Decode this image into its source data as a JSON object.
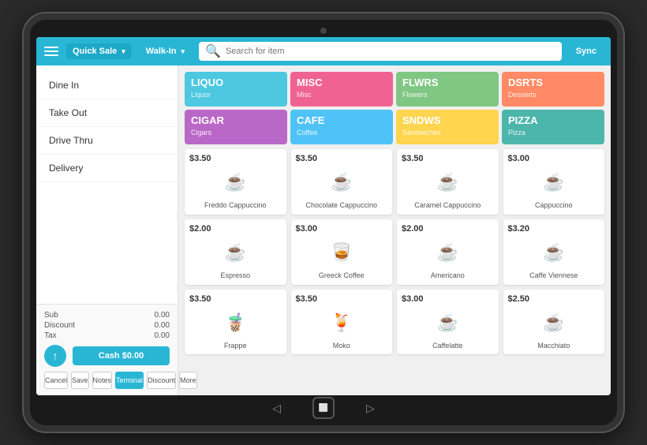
{
  "tablet": {
    "topBar": {
      "quickSale": "Quick Sale",
      "walkIn": "Walk-In",
      "searchPlaceholder": "Search for item",
      "sync": "Sync"
    },
    "leftMenu": {
      "items": [
        {
          "label": "Dine In"
        },
        {
          "label": "Take Out"
        },
        {
          "label": "Drive Thru"
        },
        {
          "label": "Delivery"
        }
      ]
    },
    "summary": {
      "sub": {
        "label": "Sub",
        "value": "0.00"
      },
      "discount": {
        "label": "Discount",
        "value": "0.00"
      },
      "tax": {
        "label": "Tax",
        "value": "0.00"
      }
    },
    "cashButton": "Cash $0.00",
    "bottomButtons": [
      {
        "label": "Cancel",
        "active": false
      },
      {
        "label": "Save",
        "active": false
      },
      {
        "label": "Notes",
        "active": false
      },
      {
        "label": "Terminal",
        "active": true
      },
      {
        "label": "Discount",
        "active": false
      },
      {
        "label": "More",
        "active": false
      }
    ],
    "categories": [
      {
        "name": "LIQUO",
        "sub": "Liquor",
        "color": "#4dc8e0"
      },
      {
        "name": "MISC",
        "sub": "Misc",
        "color": "#f06292"
      },
      {
        "name": "FLWRS",
        "sub": "Flowers",
        "color": "#81c784"
      },
      {
        "name": "DSRTS",
        "sub": "Desserts",
        "color": "#ff8a65"
      },
      {
        "name": "CIGAR",
        "sub": "Cigars",
        "color": "#ba68c8"
      },
      {
        "name": "CAFE",
        "sub": "Coffee",
        "color": "#4fc3f7"
      },
      {
        "name": "SNDWS",
        "sub": "Sandwiches",
        "color": "#ffd54f"
      },
      {
        "name": "PIZZA",
        "sub": "Pizza",
        "color": "#4db6ac"
      }
    ],
    "products": [
      {
        "name": "Freddo Cappuccino",
        "price": "$3.50",
        "icon": "☕"
      },
      {
        "name": "Chocolate Cappuccino",
        "price": "$3.50",
        "icon": "☕"
      },
      {
        "name": "Caramel Cappuccino",
        "price": "$3.50",
        "icon": "☕"
      },
      {
        "name": "Cappuccino",
        "price": "$3.00",
        "icon": "☕"
      },
      {
        "name": "Espresso",
        "price": "$2.00",
        "icon": "☕"
      },
      {
        "name": "Greeck Coffee",
        "price": "$3.00",
        "icon": "🥃"
      },
      {
        "name": "Americano",
        "price": "$2.00",
        "icon": "☕"
      },
      {
        "name": "Caffe Viennese",
        "price": "$3.20",
        "icon": "☕"
      },
      {
        "name": "Frappe",
        "price": "$3.50",
        "icon": "🧋"
      },
      {
        "name": "Moko",
        "price": "$3.50",
        "icon": "🍹"
      },
      {
        "name": "Caffelatte",
        "price": "$3.00",
        "icon": "☕"
      },
      {
        "name": "Macchiato",
        "price": "$2.50",
        "icon": "☕"
      }
    ]
  }
}
